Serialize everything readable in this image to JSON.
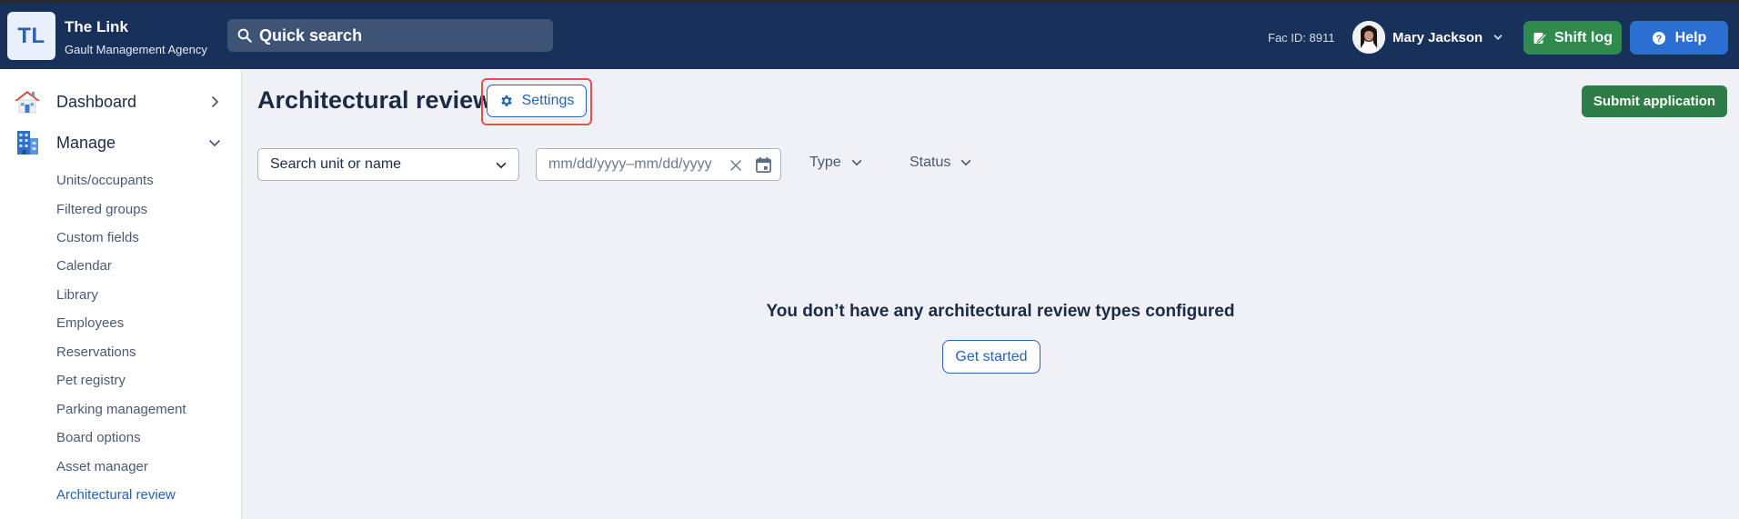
{
  "header": {
    "logo_initials": "TL",
    "app_name": "The Link",
    "org_name": "Gault Management Agency",
    "search_placeholder": "Quick search",
    "fac_id": "Fac ID: 8911",
    "user_name": "Mary Jackson",
    "shift_log_label": "Shift log",
    "help_label": "Help"
  },
  "sidebar": {
    "dashboard_label": "Dashboard",
    "manage_label": "Manage",
    "items": [
      {
        "label": "Units/occupants"
      },
      {
        "label": "Filtered groups"
      },
      {
        "label": "Custom fields"
      },
      {
        "label": "Calendar"
      },
      {
        "label": "Library"
      },
      {
        "label": "Employees"
      },
      {
        "label": "Reservations"
      },
      {
        "label": "Pet registry"
      },
      {
        "label": "Parking management"
      },
      {
        "label": "Board options"
      },
      {
        "label": "Asset manager"
      },
      {
        "label": "Architectural review"
      }
    ],
    "active_item": "Architectural review"
  },
  "main": {
    "title": "Architectural review",
    "settings_label": "Settings",
    "submit_label": "Submit application",
    "filters": {
      "search_placeholder": "Search unit or name",
      "date_placeholder": "mm/dd/yyyy–mm/dd/yyyy",
      "type_label": "Type",
      "status_label": "Status"
    },
    "empty_message": "You don’t have any architectural review types configured",
    "get_started_label": "Get started"
  },
  "colors": {
    "header_bg": "#17315a",
    "accent_blue": "#2762b4",
    "shift_green": "#2f8a4d",
    "submit_green": "#2e7d47",
    "help_blue": "#2b6fd2",
    "highlight_red": "#e0524b"
  },
  "icons": {
    "search": "search-icon",
    "shift_log": "clipboard-pen-icon",
    "help": "question-circle-icon",
    "settings": "gear-icon",
    "dashboard": "house-icon",
    "manage": "building-icon",
    "calendar": "calendar-icon",
    "clear": "close-icon"
  }
}
